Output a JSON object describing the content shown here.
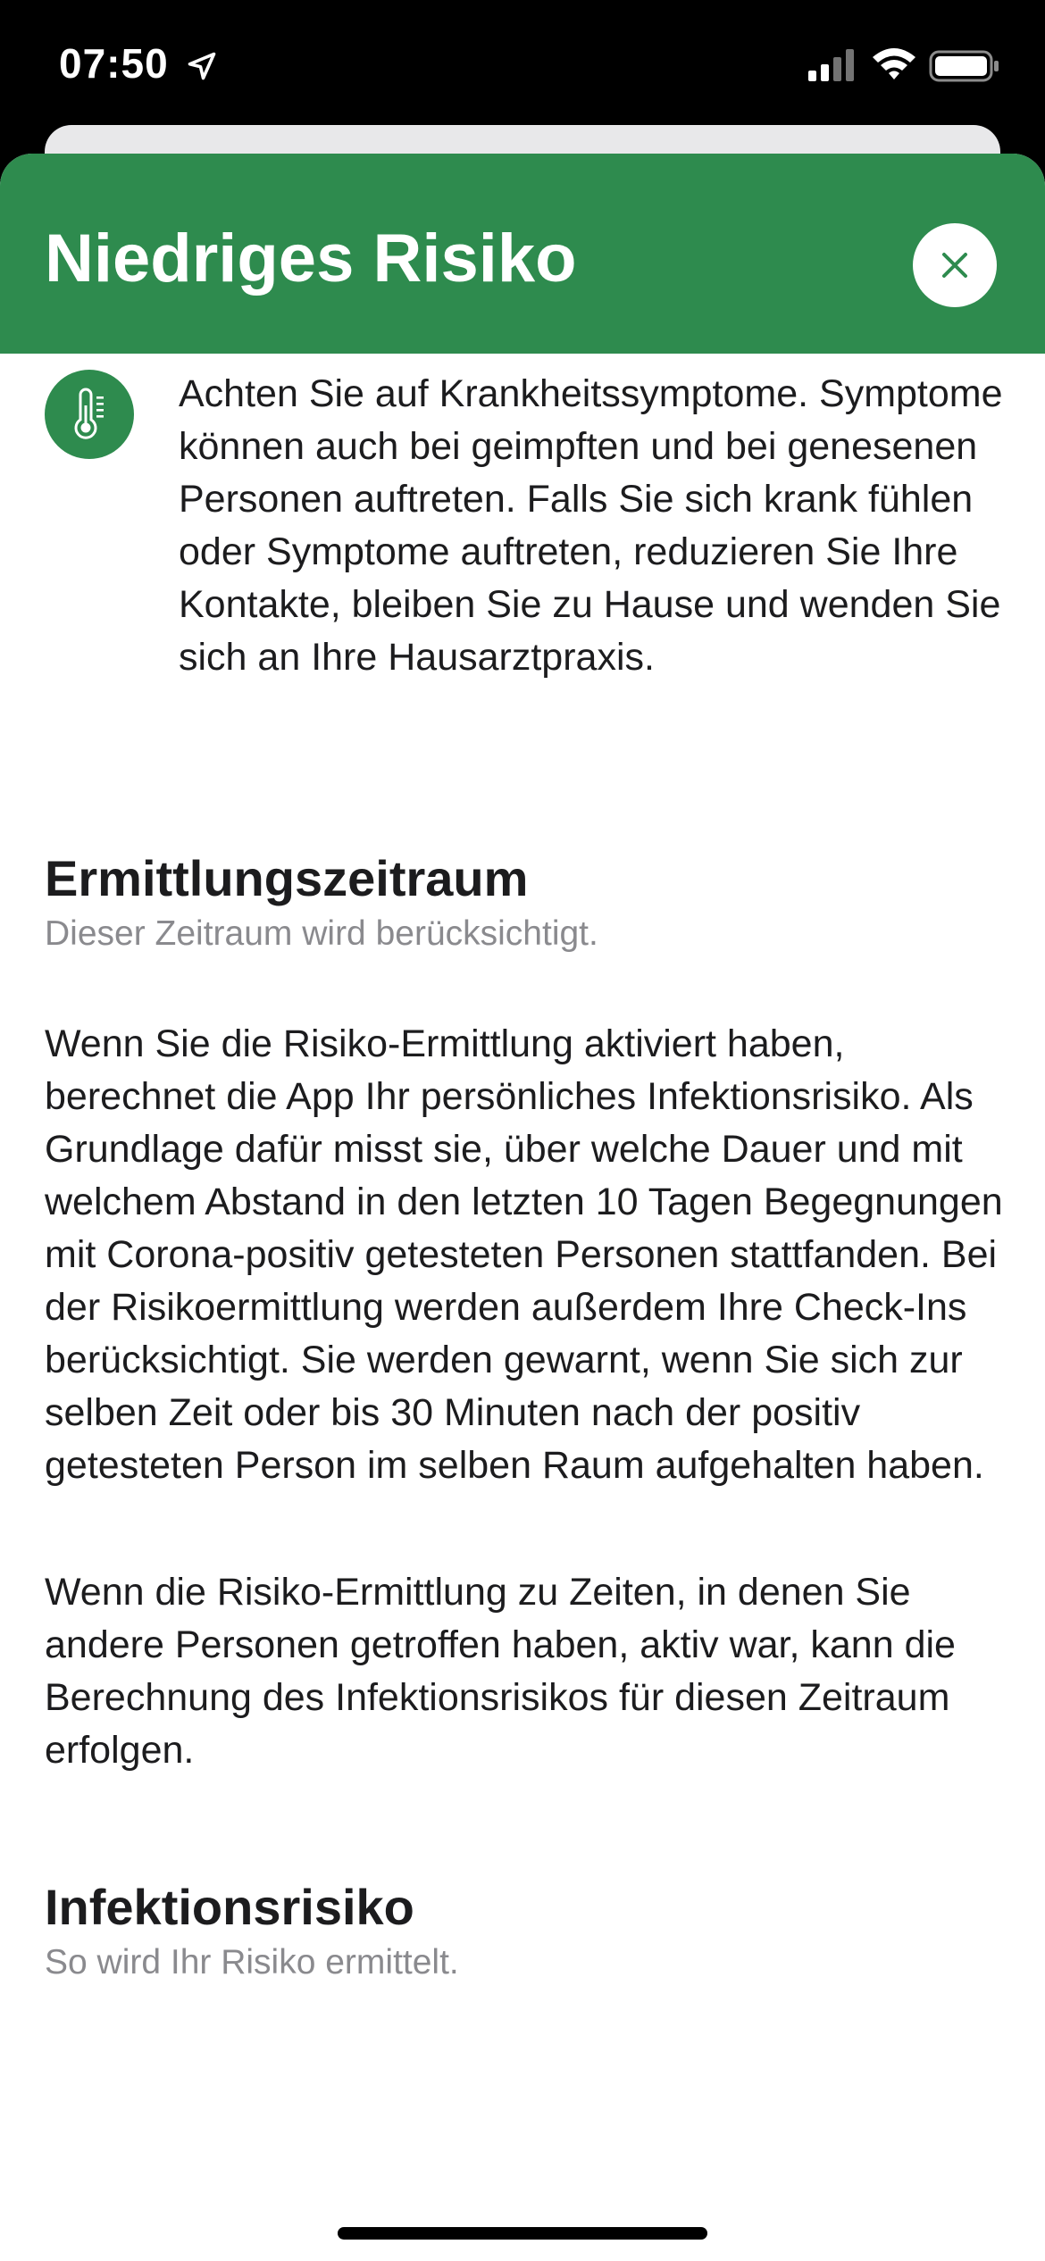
{
  "status_bar": {
    "time": "07:50"
  },
  "sheet": {
    "title": "Niedriges Risiko",
    "header_color": "#2e8b4e",
    "symptom_text": "Achten Sie auf Krankheitssymptome. Symptome können auch bei geimpften und bei genesenen Personen auftreten. Falls Sie sich krank fühlen oder Symptome auftreten, reduzieren Sie Ihre Kontakte, bleiben Sie zu Hause und wenden Sie sich an Ihre Hausarztpraxis.",
    "symptom_icon": "thermometer-icon",
    "sections": [
      {
        "title": "Ermittlungszeitraum",
        "subtitle": "Dieser Zeitraum wird berücksichtigt.",
        "paragraphs": [
          "Wenn Sie die Risiko-Ermittlung aktiviert haben, berechnet die App Ihr persönliches Infektionsrisiko. Als Grundlage dafür misst sie, über welche Dauer und mit welchem Abstand in den letzten 10 Tagen Begegnungen mit Corona-positiv getesteten Personen stattfanden. Bei der Risikoermittlung werden außerdem Ihre Check-Ins berücksichtigt. Sie werden gewarnt, wenn Sie sich zur selben Zeit oder bis 30 Minuten nach der positiv getesteten Person im selben Raum aufgehalten haben.",
          "Wenn die Risiko-Ermittlung zu Zeiten, in denen Sie andere Personen getroffen haben, aktiv war, kann die Berechnung des Infektionsrisikos für diesen Zeitraum erfolgen."
        ]
      },
      {
        "title": "Infektionsrisiko",
        "subtitle": "So wird Ihr Risiko ermittelt."
      }
    ]
  }
}
